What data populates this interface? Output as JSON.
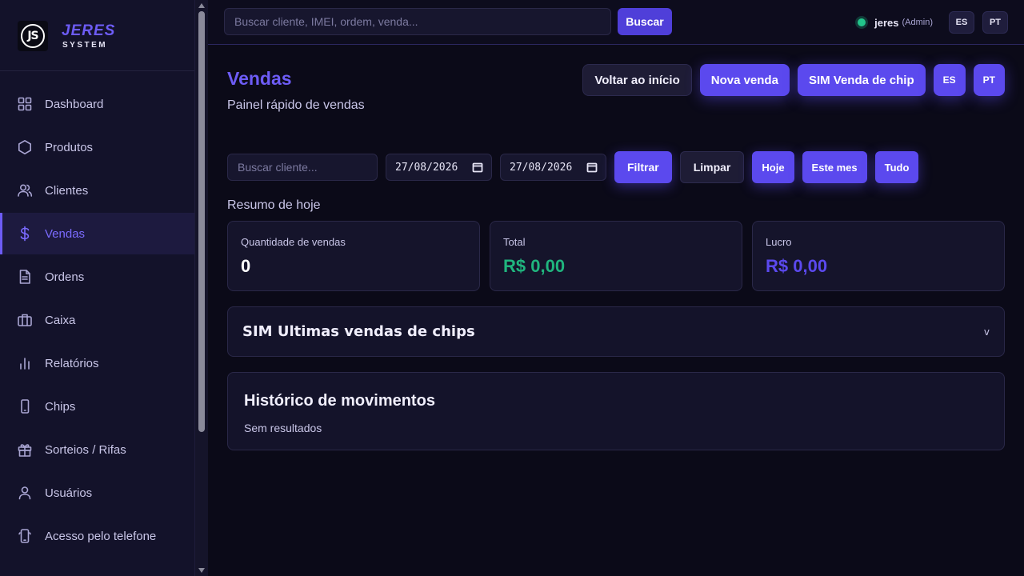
{
  "brand": {
    "logo_text": "JS",
    "name": "JERES",
    "sub": "SYSTEM"
  },
  "sidebar": {
    "items": [
      {
        "label": "Dashboard",
        "icon": "grid-icon"
      },
      {
        "label": "Produtos",
        "icon": "hexagon-icon"
      },
      {
        "label": "Clientes",
        "icon": "users-icon"
      },
      {
        "label": "Vendas",
        "icon": "dollar-icon",
        "active": true
      },
      {
        "label": "Ordens",
        "icon": "file-icon"
      },
      {
        "label": "Caixa",
        "icon": "briefcase-icon"
      },
      {
        "label": "Relatórios",
        "icon": "bar-chart-icon"
      },
      {
        "label": "Chips",
        "icon": "phone-icon"
      },
      {
        "label": "Sorteios / Rifas",
        "icon": "gift-icon"
      },
      {
        "label": "Usuários",
        "icon": "user-icon"
      },
      {
        "label": "Acesso pelo telefone",
        "icon": "smartphone-icon"
      }
    ]
  },
  "topbar": {
    "search_placeholder": "Buscar cliente, IMEI, ordem, venda...",
    "search_button": "Buscar",
    "user_name": "jeres",
    "user_role": "(Admin)",
    "lang_es": "ES",
    "lang_pt": "PT"
  },
  "page": {
    "title": "Vendas",
    "subtitle": "Painel rápido de vendas",
    "actions": {
      "back": "Voltar ao início",
      "new_sale": "Nova venda",
      "sim_sale": "SIM Venda de chip",
      "es": "ES",
      "pt": "PT"
    }
  },
  "filters": {
    "client_placeholder": "Buscar cliente...",
    "date_from": "27/08/2026",
    "date_to": "27/08/2026",
    "filter": "Filtrar",
    "clear": "Limpar",
    "today": "Hoje",
    "this_month": "Este mes",
    "all": "Tudo"
  },
  "summary": {
    "label": "Resumo de hoje",
    "cards": [
      {
        "label": "Quantidade de vendas",
        "value": "0"
      },
      {
        "label": "Total",
        "value": "R$ 0,00"
      },
      {
        "label": "Lucro",
        "value": "R$ 0,00"
      }
    ]
  },
  "accordion": {
    "title": "SIM Ultimas vendas de chips",
    "chevron": "v"
  },
  "history": {
    "title": "Histórico de movimentos",
    "empty": "Sem resultados"
  },
  "colors": {
    "accent": "#5b49ee",
    "green": "#20b57e",
    "background": "#0b0a18",
    "status": "#22c58b"
  }
}
